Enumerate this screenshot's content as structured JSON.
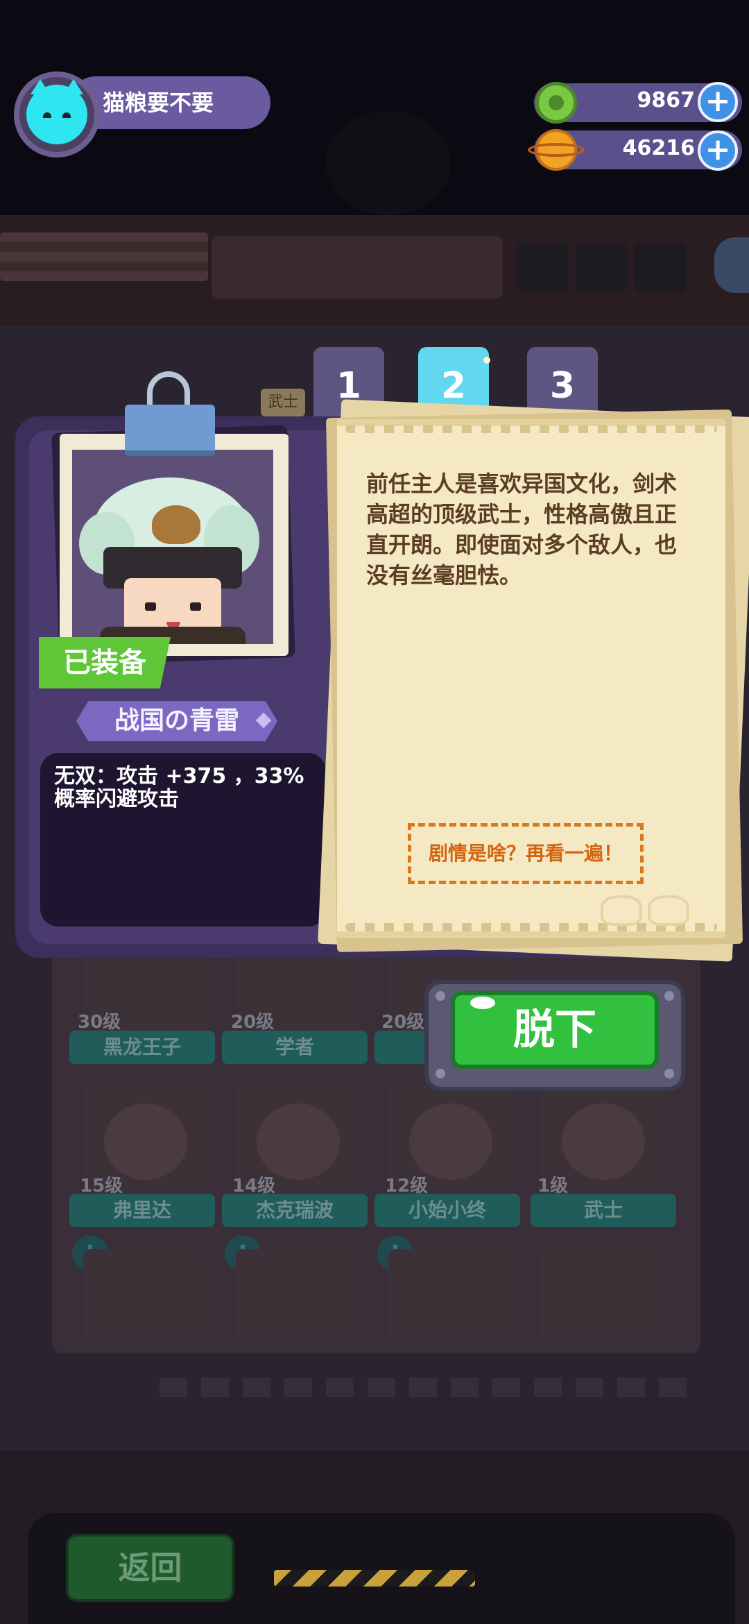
{
  "header": {
    "username": "猫粮要不要",
    "currencies": [
      {
        "icon": "green-coin-icon",
        "value": "9867"
      },
      {
        "icon": "orange-planet-coin-icon",
        "value": "46216"
      }
    ]
  },
  "tabs": [
    {
      "label": "1",
      "active": false
    },
    {
      "label": "2",
      "active": true
    },
    {
      "label": "3",
      "active": false
    }
  ],
  "character": {
    "equipped_label": "已装备",
    "outfit_name": "战国の青雷",
    "skill": "无双：攻击 +375 ，33%概率闪避攻击",
    "story": "前任主人是喜欢异国文化，剑术高超的顶级武士，性格高傲且正直开朗。即使面对多个敌人，也没有丝毫胆怯。",
    "replay_story": "剧情是啥？再看一遍！"
  },
  "actions": {
    "take_off": "脱下",
    "back": "返回"
  },
  "background_roster": [
    {
      "level": "30级",
      "name": "黑龙王子"
    },
    {
      "level": "20级",
      "name": "学者"
    },
    {
      "level": "20级",
      "name": ""
    },
    {
      "level": "15级",
      "name": "弗里达"
    },
    {
      "level": "14级",
      "name": "杰克瑞波"
    },
    {
      "level": "12级",
      "name": "小始小终"
    },
    {
      "level": "1级",
      "name": "武士"
    }
  ],
  "background_peek": {
    "left_tab_tag": "武士"
  },
  "colors": {
    "modal": "#3d2f5c",
    "parchment": "#f5e9c4",
    "accent_green": "#31c13f",
    "accent_cyan": "#61d8f0",
    "story_text": "#5a3d24",
    "replay_orange": "#d2650f"
  }
}
